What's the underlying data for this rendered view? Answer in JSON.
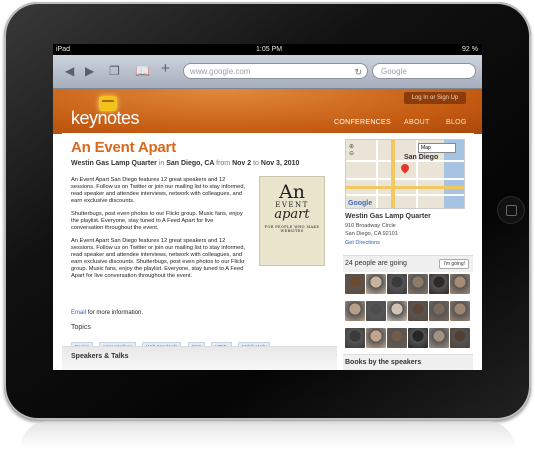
{
  "status": {
    "carrier": "iPad",
    "time": "1:05 PM",
    "battery": "92 %"
  },
  "browser": {
    "url": "www.google.com",
    "search_placeholder": "Google",
    "icons": [
      "back-arrow-icon",
      "forward-arrow-icon",
      "tabs-icon",
      "bookmarks-icon",
      "add-icon",
      "reload-icon"
    ]
  },
  "site": {
    "logo": "keynotes",
    "auth": {
      "login": "Log In",
      "sep": "or",
      "signup": "Sign Up"
    },
    "nav": [
      "CONFERENCES",
      "ABOUT",
      "BLOG"
    ]
  },
  "event": {
    "title": "An Event Apart",
    "venue": "Westin Gas Lamp Quarter",
    "in": "in",
    "city": "San Diego, CA",
    "from": "from",
    "start": "Nov 2",
    "to": "to",
    "end": "Nov 3, 2010",
    "paragraphs": [
      "An Event Apart San Diego features 12 great speakers and 12 sessions. Follow us on Twitter or join our mailing list to stay informed, read speaker and attendee interviews, network with colleagues, and earn exclusive discounts.",
      "Shutterbugs, post even photos to our Flickr group. Music fans, enjoy the playlist. Everyone, stay tuned to A Feed Apart for live conversation throughout the event.",
      "An Event Apart San Diego features 12 great speakers and 12 sessions. Follow us on Twitter or join our mailing list to stay informed, read speaker and attendee interviews, network with colleagues, and earn exclusive discounts. Shutterbugs, post even photos to our Flickr group. Music fans, enjoy the playlist. Everyone, stay tuned to A Feed Apart for live conversation throughout the event."
    ],
    "email_link": "Email",
    "email_rest": "for more information.",
    "topics_label": "Topics",
    "topics": [
      "Design",
      "User Interface",
      "Web Standards",
      "CSS",
      "HTML",
      "Mobile Web"
    ],
    "speakers_label": "Speakers & Talks",
    "book_cover": {
      "line1": "An",
      "line2": "EVENT",
      "line3": "apart",
      "line4": "FOR PEOPLE WHO MAKE WEBSITES"
    }
  },
  "sidebar": {
    "map_type": "Map",
    "map_city": "San Diego",
    "google_logo": "Google",
    "venue_name": "Westin Gas Lamp Quarter",
    "address1": "910 Broadway Circle",
    "address2": "San Diego, CA 92101",
    "directions": "Get Directions",
    "people_count": "24 people are going",
    "going_button": "I'm going!",
    "books_label": "Books by the speakers",
    "avatar_colors": [
      "#6b4a32",
      "#c8b39c",
      "#3a3a3a",
      "#8c7a66",
      "#2e2a28",
      "#a88b74",
      "#b89f8a",
      "#4d4d4d",
      "#d0c3b3",
      "#5e4636",
      "#7a6a5c",
      "#9d8570",
      "#3b3b3b",
      "#c2a48b",
      "#6f5b4a",
      "#262626",
      "#a29080",
      "#514033"
    ]
  }
}
